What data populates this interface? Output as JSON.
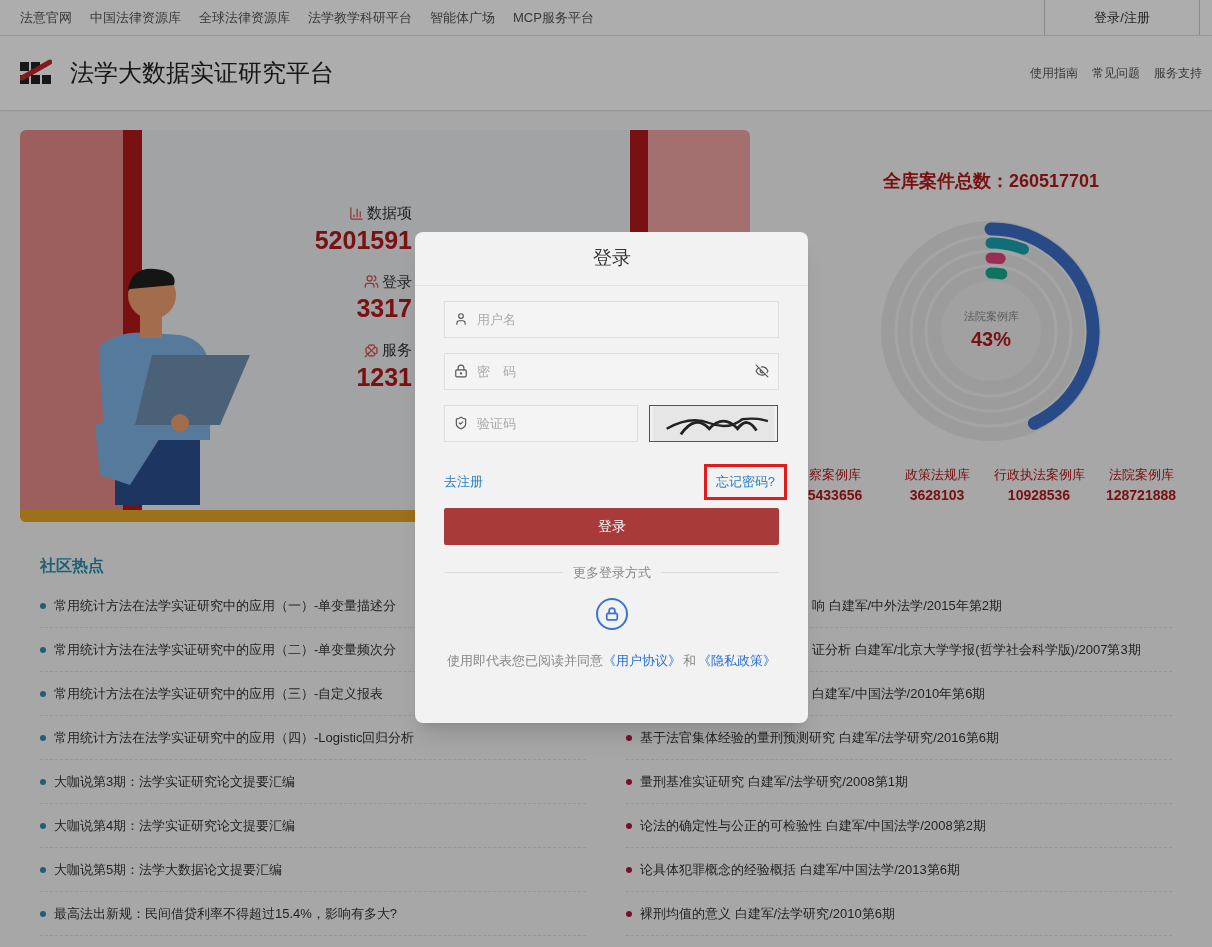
{
  "top_nav": {
    "links": [
      "法意官网",
      "中国法律资源库",
      "全球法律资源库",
      "法学教学科研平台",
      "智能体广场",
      "MCP服务平台"
    ],
    "login_link": "登录/注册"
  },
  "header": {
    "title": "法学大数据实证研究平台",
    "links": [
      "使用指南",
      "常见问题",
      "服务支持"
    ]
  },
  "banner": {
    "stats": [
      {
        "label": "数据项",
        "value": "5201591"
      },
      {
        "label": "登录",
        "value": "3317"
      },
      {
        "label": "服务",
        "value": "1231"
      }
    ]
  },
  "case_summary": {
    "title": "全库案件总数：260517701",
    "center_label": "法院案例库",
    "center_value": "43%",
    "libraries": [
      {
        "name": "察案例库",
        "count": "5433656"
      },
      {
        "name": "政策法规库",
        "count": "3628103"
      },
      {
        "name": "行政执法案例库",
        "count": "10928536"
      },
      {
        "name": "法院案例库",
        "count": "128721888"
      }
    ]
  },
  "community": {
    "title": "社区热点",
    "left_items": [
      {
        "text": "常用统计方法在法学实证研究中的应用（一）-单变量描述分"
      },
      {
        "text": "常用统计方法在法学实证研究中的应用（二）-单变量频次分"
      },
      {
        "text": "常用统计方法在法学实证研究中的应用（三）-自定义报表"
      },
      {
        "text": "常用统计方法在法学实证研究中的应用（四）-Logistic回归分析"
      },
      {
        "text": "大咖说第3期：法学实证研究论文提要汇编"
      },
      {
        "text": "大咖说第4期：法学实证研究论文提要汇编"
      },
      {
        "text": "大咖说第5期：法学大数据论文提要汇编"
      },
      {
        "text": "最高法出新规：民间借贷利率不得超过15.4%，影响有多大?"
      }
    ],
    "right_items": [
      {
        "text": "响 白建军/中外法学/2015年第2期",
        "covered": true
      },
      {
        "text": "证分析 白建军/北京大学学报(哲学社会科学版)/2007第3期",
        "covered": true
      },
      {
        "text": "白建军/中国法学/2010年第6期",
        "covered": true
      },
      {
        "text": "基于法官集体经验的量刑预测研究 白建军/法学研究/2016第6期",
        "covered": false
      },
      {
        "text": "量刑基准实证研究 白建军/法学研究/2008第1期",
        "covered": false
      },
      {
        "text": "论法的确定性与公正的可检验性 白建军/中国法学/2008第2期",
        "covered": false
      },
      {
        "text": "论具体犯罪概念的经验概括 白建军/中国法学/2013第6期",
        "covered": false
      },
      {
        "text": "裸刑均值的意义 白建军/法学研究/2010第6期",
        "covered": false
      }
    ]
  },
  "login_dialog": {
    "title": "登录",
    "username": {
      "placeholder": "用户名"
    },
    "password": {
      "placeholder": "密　码"
    },
    "captcha": {
      "placeholder": "验证码"
    },
    "register_link": "去注册",
    "forgot_link": "忘记密码?",
    "forgot_highlighted": true,
    "submit": "登录",
    "more_methods": "更多登录方式",
    "agreement": {
      "prefix": "使用即代表您已阅读并同意",
      "user_agreement": "《用户协议》",
      "joiner": "和",
      "privacy_policy": "《隐私政策》"
    }
  }
}
